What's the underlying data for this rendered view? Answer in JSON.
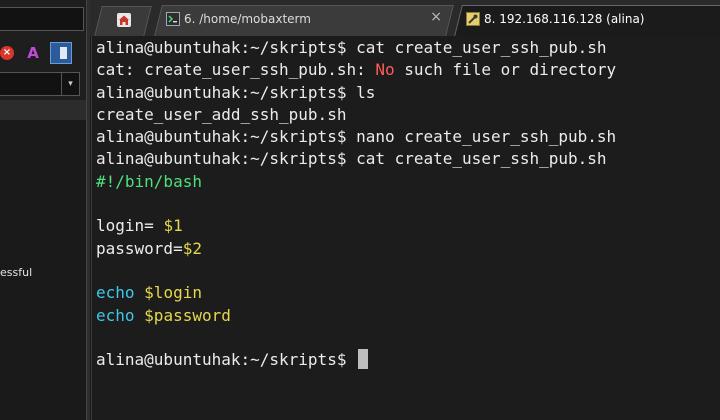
{
  "sidebar": {
    "close_glyph": "×",
    "aa_glyph": "A",
    "chevron_glyph": "▾",
    "partial_text": "essful"
  },
  "tabs": [
    {
      "label": "6. /home/mobaxterm",
      "close": "×",
      "active": false
    },
    {
      "label": "8. 192.168.116.128 (alina)",
      "active": true
    }
  ],
  "terminal": {
    "lines": [
      {
        "text": "alina@ubuntuhak:~/skripts$ cat create_user_ssh_pub.sh"
      },
      {
        "pre": "cat: create_user_ssh_pub.sh: ",
        "err": "No",
        "post": " such file or directory"
      },
      {
        "text": "alina@ubuntuhak:~/skripts$ ls"
      },
      {
        "text": "create_user_add_ssh_pub.sh"
      },
      {
        "text": "alina@ubuntuhak:~/skripts$ nano create_user_ssh_pub.sh"
      },
      {
        "text": "alina@ubuntuhak:~/skripts$ cat create_user_ssh_pub.sh"
      },
      {
        "text": "#!/bin/bash"
      },
      {
        "text": ""
      },
      {
        "pre": "login= ",
        "var": "$1"
      },
      {
        "pre": "password=",
        "var": "$2"
      },
      {
        "text": ""
      },
      {
        "cmd": "echo",
        "var": "$login"
      },
      {
        "cmd": "echo",
        "var": "$password"
      },
      {
        "text": ""
      },
      {
        "text": "alina@ubuntuhak:~/skripts$ "
      }
    ]
  }
}
